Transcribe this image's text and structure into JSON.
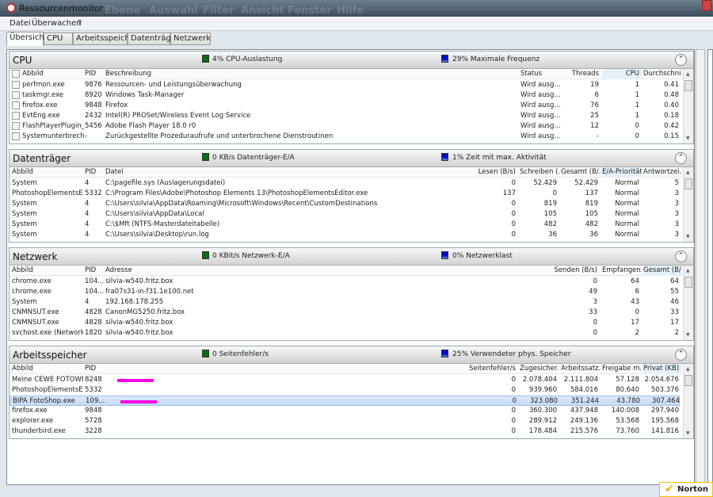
{
  "window": {
    "title": "Ressourcenmonitor",
    "background_menu": [
      "Ebene",
      "Auswahl",
      "Filter",
      "Ansicht",
      "Fenster",
      "Hilfe"
    ]
  },
  "menu": [
    "Datei",
    "Überwachen",
    "?"
  ],
  "tabs": [
    "Übersicht",
    "CPU",
    "Arbeitsspeicher",
    "Datenträger",
    "Netzwerk"
  ],
  "sections": [
    {
      "id": "cpu",
      "title": "CPU",
      "ind1": "4% CPU-Auslastung",
      "ind2": "29% Maximale Frequenz",
      "columns": [
        "Abbild",
        "PID",
        "Beschreibung",
        "Status",
        "Threads",
        "CPU",
        "Durchschni..."
      ],
      "rows": [
        [
          "perfmon.exe",
          "9876",
          "Ressourcen- und Leistungsüberwachung",
          "Wird ausg...",
          "19",
          "1",
          "0.41"
        ],
        [
          "taskmgr.exe",
          "8920",
          "Windows Task-Manager",
          "Wird ausg...",
          "6",
          "1",
          "0.48"
        ],
        [
          "firefox.exe",
          "9848",
          "Firefox",
          "Wird ausg...",
          "76",
          "1",
          "0.40"
        ],
        [
          "EvtEng.exe",
          "2432",
          "Intel(R) PROSet/Wireless Event Log Service",
          "Wird ausg...",
          "25",
          "1",
          "0.18"
        ],
        [
          "FlashPlayerPlugin_...",
          "5456",
          "Adobe Flash Player 18.0 r0",
          "Wird ausg...",
          "12",
          "0",
          "0.42"
        ],
        [
          "Systemunterbrechu...",
          "-",
          "Zurückgestellte Prozeduraufrufe und unterbrochene Dienstroutinen",
          "Wird ausg...",
          "-",
          "0",
          "0.15"
        ]
      ]
    },
    {
      "id": "disk",
      "title": "Datenträger",
      "ind1": "0 KB/s Datenträger-E/A",
      "ind2": "1% Zeit mit max. Aktivität",
      "columns": [
        "Abbild",
        "PID",
        "Datei",
        "Lesen (B/s)",
        "Schreiben (...",
        "Gesamt (B/...",
        "E/A-Priorität",
        "Antwortzei..."
      ],
      "rows": [
        [
          "System",
          "4",
          "C:\\pagefile.sys (Auslagerungsdatei)",
          "0",
          "52.429",
          "52.429",
          "Normal",
          "5"
        ],
        [
          "PhotoshopElementsEdi...",
          "5332",
          "C:\\Program Files\\Adobe\\Photoshop Elements 13\\PhotoshopElementsEditor.exe",
          "137",
          "0",
          "137",
          "Normal",
          "3"
        ],
        [
          "System",
          "4",
          "C:\\Users\\silvia\\AppData\\Roaming\\Microsoft\\Windows\\Recent\\CustomDestinations",
          "0",
          "819",
          "819",
          "Normal",
          "3"
        ],
        [
          "System",
          "4",
          "C:\\Users\\silvia\\AppData\\Local",
          "0",
          "105",
          "105",
          "Normal",
          "3"
        ],
        [
          "System",
          "4",
          "C:\\$Mft (NTFS-Masterdateitabelle)",
          "0",
          "482",
          "482",
          "Normal",
          "3"
        ],
        [
          "System",
          "4",
          "C:\\Users\\silvia\\Desktop\\run.log",
          "0",
          "36",
          "36",
          "Normal",
          "3"
        ]
      ]
    },
    {
      "id": "net",
      "title": "Netzwerk",
      "ind1": "0 KBit/s Netzwerk-E/A",
      "ind2": "0% Netzwerklast",
      "columns": [
        "Abbild",
        "PID",
        "Adresse",
        "Senden (B/s)",
        "Empfangen...",
        "Gesamt (B/..."
      ],
      "rows": [
        [
          "chrome.exe",
          "104...",
          "silvia-w540.fritz.box",
          "0",
          "64",
          "64"
        ],
        [
          "chrome.exe",
          "104...",
          "fra07s31-in-f31.1e100.net",
          "49",
          "6",
          "55"
        ],
        [
          "System",
          "4",
          "192.168.178.255",
          "3",
          "43",
          "46"
        ],
        [
          "CNMNSUT.exe",
          "4828",
          "CanonMG5250.fritz.box",
          "33",
          "0",
          "33"
        ],
        [
          "CNMNSUT.exe",
          "4828",
          "silvia-w540.fritz.box",
          "0",
          "17",
          "17"
        ],
        [
          "svchost.exe (NetworkS...",
          "1820",
          "silvia-w540.fritz.box",
          "0",
          "2",
          "2"
        ]
      ]
    },
    {
      "id": "mem",
      "title": "Arbeitsspeicher",
      "ind1": "0 Seitenfehler/s",
      "ind2": "25% Verwendeter phys. Speicher",
      "columns": [
        "Abbild",
        "PID",
        "Seitenfehler/s",
        "Zugesicher...",
        "Arbeitssatz...",
        "Freigabe m...",
        "Privat (KB)"
      ],
      "rows": [
        [
          "Meine CEWE FOTOWE...",
          "8248",
          "0",
          "2.078.404",
          "2.111.804",
          "57.128",
          "2.054.676"
        ],
        [
          "PhotoshopElementsEdi...",
          "5332",
          "0",
          "939.960",
          "584.016",
          "80.640",
          "503.376"
        ],
        [
          "BIPA FotoShop.exe",
          "109...",
          "0",
          "323.080",
          "351.244",
          "43.780",
          "307.464"
        ],
        [
          "firefox.exe",
          "9848",
          "0",
          "360.300",
          "437.948",
          "140.008",
          "297.940"
        ],
        [
          "explorer.exe",
          "5728",
          "0",
          "289.912",
          "249.136",
          "53.568",
          "195.568"
        ],
        [
          "thunderbird.exe",
          "3228",
          "0",
          "178.484",
          "215.576",
          "73.760",
          "141.816"
        ]
      ]
    }
  ],
  "badge": {
    "label": "Norton"
  }
}
